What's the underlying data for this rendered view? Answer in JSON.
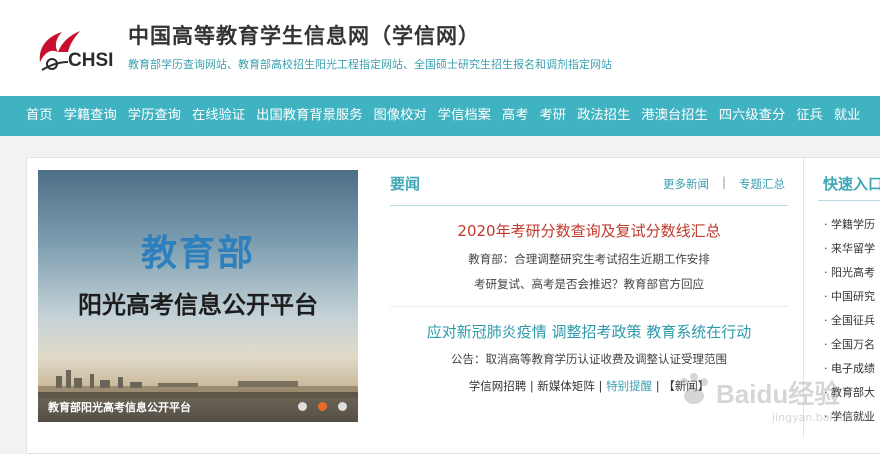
{
  "header": {
    "logo_text": "CHSI",
    "title": "中国高等教育学生信息网（学信网）",
    "subtitle": "教育部学历查询网站、教育部高校招生阳光工程指定网站、全国硕士研究生招生报名和调剂指定网站"
  },
  "nav": {
    "items": [
      "首页",
      "学籍查询",
      "学历查询",
      "在线验证",
      "出国教育背景服务",
      "图像校对",
      "学信档案",
      "高考",
      "考研",
      "政法招生",
      "港澳台招生",
      "四六级查分",
      "征兵",
      "就业"
    ]
  },
  "banner": {
    "title": "教育部",
    "subtitle": "阳光高考信息公开平台",
    "caption": "教育部阳光高考信息公开平台",
    "active_slide": 2,
    "slide_count": 3
  },
  "news": {
    "heading": "要闻",
    "more_label": "更多新闻",
    "separator": "|",
    "topics_label": "专题汇总",
    "headline1": "2020年考研分数查询及复试分数线汇总",
    "sub1": "教育部：合理调整研究生考试招生近期工作安排",
    "sub2": "考研复试、高考是否会推迟？教育部官方回应",
    "headline2": "应对新冠肺炎疫情 调整招考政策 教育系统在行动",
    "sub3": "公告：取消高等教育学历认证收费及调整认证受理范围",
    "links": [
      "学信网招聘",
      "新媒体矩阵",
      "特别提醒",
      "【新闻】"
    ],
    "link_sep": " | "
  },
  "quick": {
    "heading": "快速入口",
    "items": [
      "学籍学历",
      "来华留学",
      "阳光高考",
      "中国研究",
      "全国征兵",
      "全国万名",
      "电子成绩",
      "教育部大",
      "学信就业"
    ]
  },
  "colors": {
    "accent": "#3fb3c1",
    "headline_red": "#c0392b",
    "headline_teal": "#2e9aab",
    "logo_red": "#c8102e"
  },
  "watermark": {
    "text": "Baidu经验",
    "sub": "jingyan.baidu.com"
  }
}
